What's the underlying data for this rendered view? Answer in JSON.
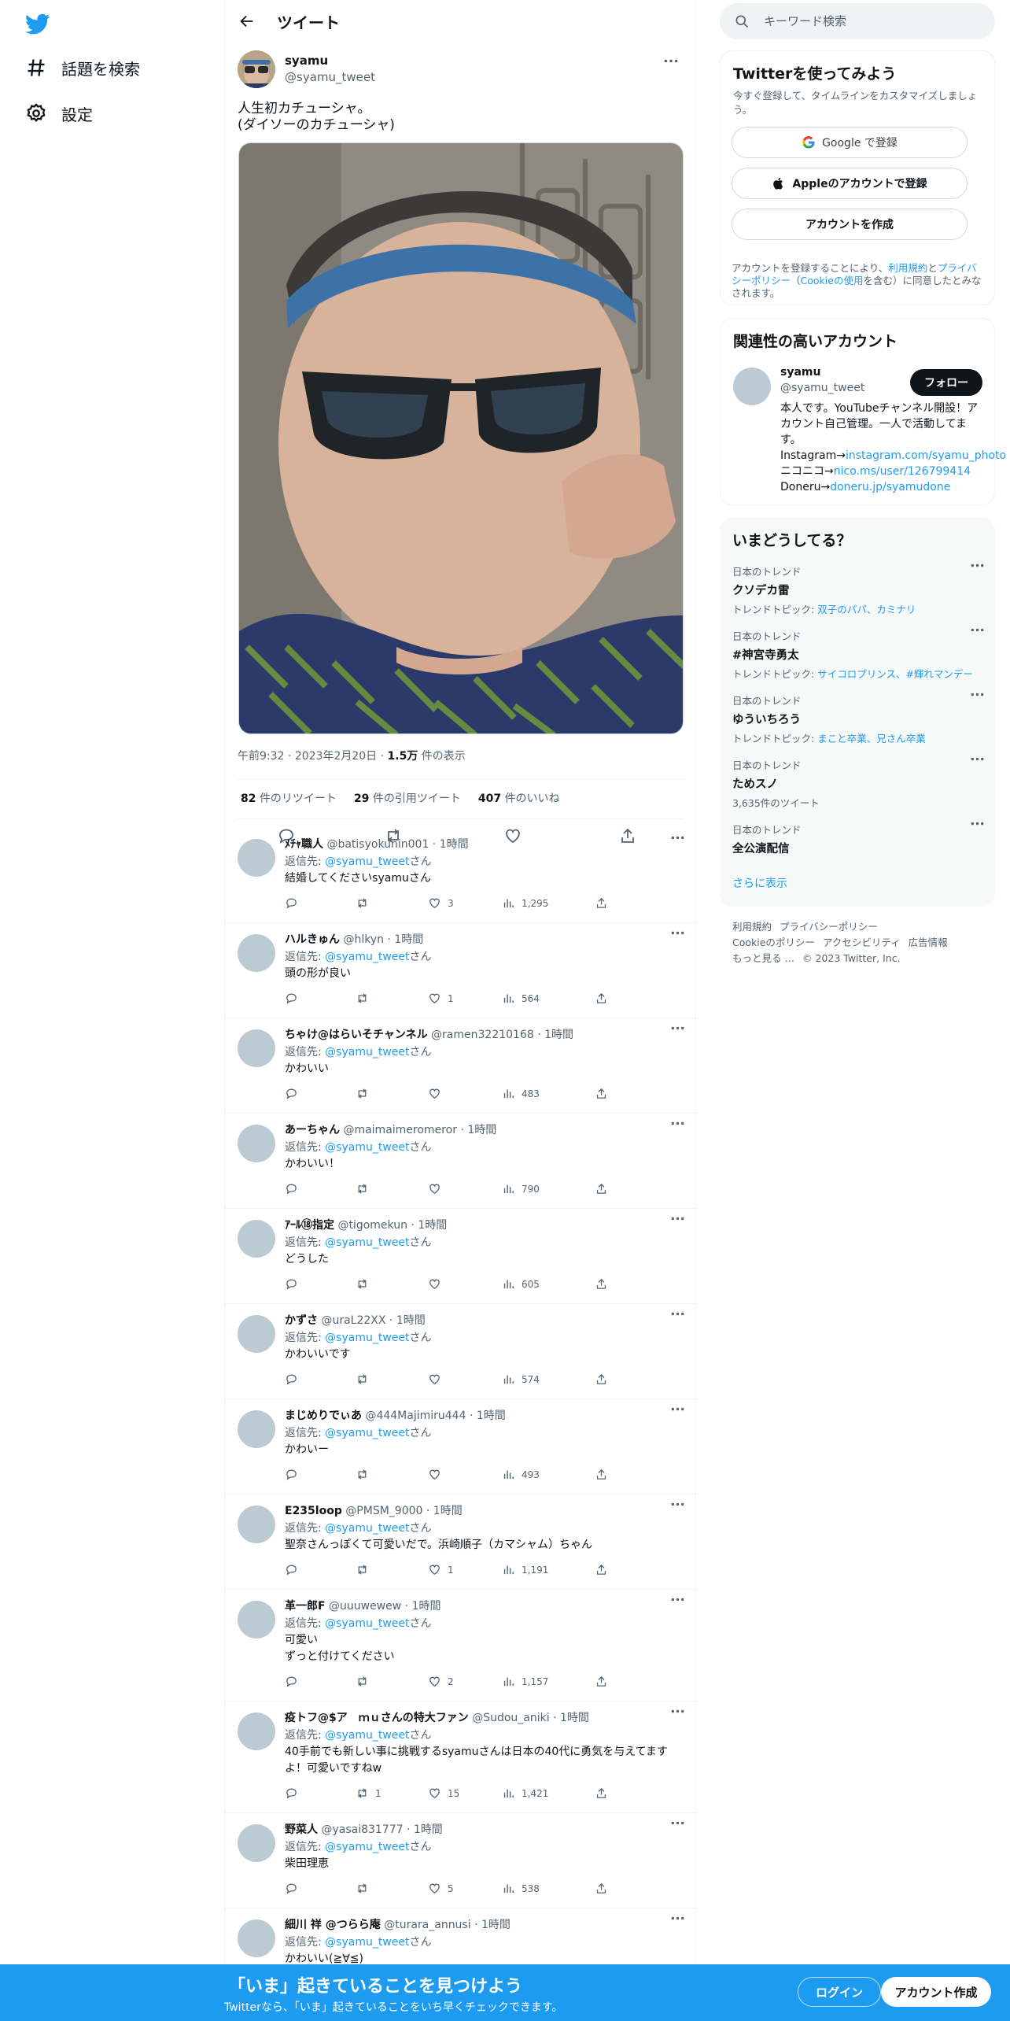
{
  "nav": {
    "items": [
      {
        "label": "話題を検索",
        "icon": "hashtag-icon"
      },
      {
        "label": "設定",
        "icon": "gear-icon"
      }
    ]
  },
  "header": {
    "title": "ツイート"
  },
  "tweet": {
    "name": "syamu",
    "handle": "@syamu_tweet",
    "text": "人生初カチューシャ。\n(ダイソーのカチューシャ)",
    "time": "午前9:32",
    "date": "2023年2月20日",
    "views_count": "1.5万",
    "views_label": "件の表示",
    "retweets_count": "82",
    "retweets_label": "件のリツイート",
    "quotes_count": "29",
    "quotes_label": "件の引用ツイート",
    "likes_count": "407",
    "likes_label": "件のいいね"
  },
  "reply_to_label": "返信先: ",
  "reply_to_handle": "@syamu_tweet",
  "reply_to_suffix": "さん",
  "replies": [
    {
      "name": "ﾒﾁｬ職人",
      "handle": "@batisyokunin001",
      "time": "1時間",
      "text": "結婚してくださいsyamuさん",
      "replies": "",
      "retweets": "",
      "likes": "3",
      "views": "1,295"
    },
    {
      "name": "ハルきゅん",
      "handle": "@hlkyn",
      "time": "1時間",
      "text": "頭の形が良い",
      "replies": "",
      "retweets": "",
      "likes": "1",
      "views": "564"
    },
    {
      "name": "ちゃけ@はらいそチャンネル",
      "handle": "@ramen32210168",
      "time": "1時間",
      "text": "かわいい",
      "replies": "",
      "retweets": "",
      "likes": "",
      "views": "483"
    },
    {
      "name": "あーちゃん",
      "handle": "@maimaimeromeror",
      "time": "1時間",
      "text": "かわいい！",
      "replies": "",
      "retweets": "",
      "likes": "",
      "views": "790"
    },
    {
      "name": "ｱｰﾙ⑱指定",
      "handle": "@tigomekun",
      "time": "1時間",
      "text": "どうした",
      "replies": "",
      "retweets": "",
      "likes": "",
      "views": "605"
    },
    {
      "name": "かずさ",
      "handle": "@uraL22XX",
      "time": "1時間",
      "text": "かわいいです",
      "replies": "",
      "retweets": "",
      "likes": "",
      "views": "574"
    },
    {
      "name": "まじめりでぃあ",
      "handle": "@444Majimiru444",
      "time": "1時間",
      "text": "かわいー",
      "replies": "",
      "retweets": "",
      "likes": "",
      "views": "493"
    },
    {
      "name": "E235loop",
      "handle": "@PMSM_9000",
      "time": "1時間",
      "text": "聖奈さんっぽくて可愛いだで。浜崎順子（カマシャム）ちゃん",
      "replies": "",
      "retweets": "",
      "likes": "1",
      "views": "1,191"
    },
    {
      "name": "革一郎F",
      "handle": "@uuuwewew",
      "time": "1時間",
      "text": "可愛い\nずっと付けてください",
      "replies": "",
      "retweets": "",
      "likes": "2",
      "views": "1,157"
    },
    {
      "name": "疫トフ@$ア　ｍｕさんの特大ファン",
      "handle": "@Sudou_aniki",
      "time": "1時間",
      "text": "40手前でも新しい事に挑戦するsyamuさんは日本の40代に勇気を与えてますよ！可愛いですねw",
      "replies": "",
      "retweets": "1",
      "likes": "15",
      "views": "1,421"
    },
    {
      "name": "野菜人",
      "handle": "@yasai831777",
      "time": "1時間",
      "text": "柴田理恵",
      "replies": "",
      "retweets": "",
      "likes": "5",
      "views": "538"
    },
    {
      "name": "細川 祥 @つらら庵",
      "handle": "@turara_annusi",
      "time": "1時間",
      "text": "かわいい(≧∀≦)",
      "replies": "",
      "retweets": "",
      "likes": "",
      "views": ""
    }
  ],
  "search": {
    "placeholder": "キーワード検索"
  },
  "signup": {
    "title": "Twitterを使ってみよう",
    "desc": "今すぐ登録して、タイムラインをカスタマイズしましょう。",
    "google": "Google で登録",
    "apple": "Appleのアカウントで登録",
    "create": "アカウントを作成",
    "legal_pre": "アカウントを登録することにより、",
    "legal_terms": "利用規約",
    "legal_and": "と",
    "legal_privacy": "プライバシーポリシー",
    "legal_paren_open": "（",
    "legal_cookie": "Cookieの使用",
    "legal_post": "を含む）に同意したとみなされます。"
  },
  "related": {
    "title": "関連性の高いアカウント",
    "name": "syamu",
    "handle": "@syamu_tweet",
    "follow": "フォロー",
    "bio_1": "本人です。YouTubeチャンネル開設！アカウント自己管理。一人で活動してます。 Instagram→",
    "bio_link1": "instagram.com/syamu_photo",
    "bio_2": " ニコニコ→",
    "bio_link2": "nico.ms/user/126799414",
    "bio_3": " Doneru→",
    "bio_link3": "doneru.jp/syamudone"
  },
  "trends": {
    "title": "いまどうしてる？",
    "items": [
      {
        "context": "日本のトレンド",
        "name": "クソデカ雷",
        "sub_label": "トレンドトピック: ",
        "sub_link": "双子のパパ、カミナリ"
      },
      {
        "context": "日本のトレンド",
        "name": "#神宮寺勇太",
        "sub_label": "トレンドトピック: ",
        "sub_link": "サイコロプリンス、#輝れマンデー"
      },
      {
        "context": "日本のトレンド",
        "name": "ゆういちろう",
        "sub_label": "トレンドトピック: ",
        "sub_link": "まこと卒業、兄さん卒業"
      },
      {
        "context": "日本のトレンド",
        "name": "ためスノ",
        "sub_label": "3,635件のツイート",
        "sub_link": ""
      },
      {
        "context": "日本のトレンド",
        "name": "全公演配信",
        "sub_label": "",
        "sub_link": ""
      }
    ],
    "show_more": "さらに表示"
  },
  "footer": {
    "terms": "利用規約",
    "privacy": "プライバシーポリシー",
    "cookie": "Cookieのポリシー",
    "access": "アクセシビリティ",
    "ads": "広告情報",
    "more": "もっと見る …",
    "copyright": "© 2023 Twitter, Inc."
  },
  "banner": {
    "title": "「いま」起きていることを見つけよう",
    "sub": "Twitterなら、「いま」起きていることをいち早くチェックできます。",
    "login": "ログイン",
    "signup": "アカウント作成"
  },
  "colors": {
    "accent": "#1d9bf0",
    "text": "#0f1419",
    "muted": "#536471"
  }
}
